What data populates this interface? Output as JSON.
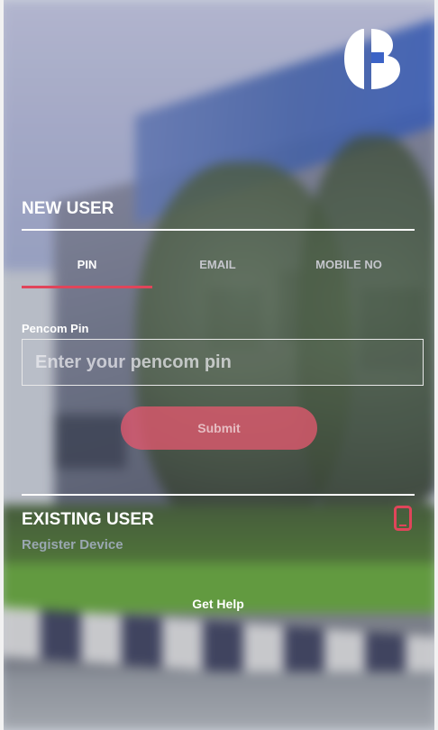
{
  "new_user": {
    "title": "NEW USER",
    "tabs": [
      {
        "label": "PIN",
        "active": true
      },
      {
        "label": "EMAIL",
        "active": false
      },
      {
        "label": "MOBILE NO",
        "active": false
      }
    ],
    "field_label": "Pencom Pin",
    "input_placeholder": "Enter your pencom pin",
    "input_value": "",
    "submit_label": "Submit"
  },
  "existing_user": {
    "title": "EXISTING USER",
    "register_label": "Register Device",
    "icon": "mobile-phone-icon"
  },
  "help_label": "Get Help",
  "colors": {
    "accent": "#e0455a",
    "submit_bg": "#e2586e",
    "text": "#ffffff"
  }
}
